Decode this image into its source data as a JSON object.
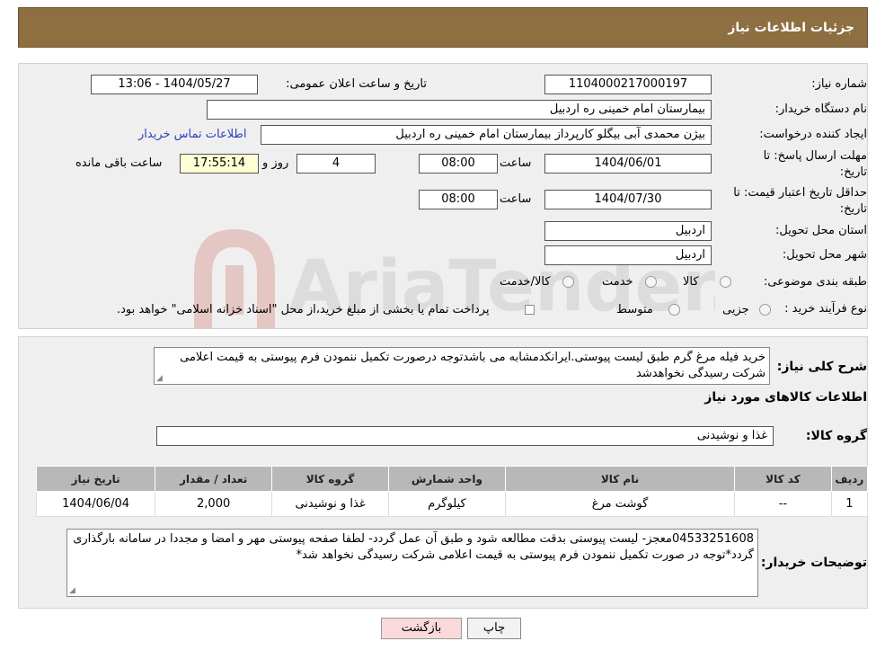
{
  "header": {
    "title": "جزئیات اطلاعات نیاز"
  },
  "form": {
    "need_number": {
      "label": "شماره نیاز:",
      "value": "1104000217000197"
    },
    "announce_datetime": {
      "label": "تاریخ و ساعت اعلان عمومی:",
      "value": "1404/05/27 - 13:06"
    },
    "buyer_org": {
      "label": "نام دستگاه خریدار:",
      "value": "بیمارستان امام خمینی  ره  اردبیل"
    },
    "requester": {
      "label": "ایجاد کننده درخواست:",
      "value": "بیژن محمدی آبی بیگلو کارپرداز بیمارستان امام خمینی  ره  اردبیل"
    },
    "contact_link": "اطلاعات تماس خریدار",
    "reply_deadline": {
      "label_line1": "مهلت ارسال پاسخ: تا",
      "label_line2": "تاریخ:",
      "date": "1404/06/01",
      "time_label": "ساعت",
      "time": "08:00",
      "days": "4",
      "days_label": "روز و",
      "remaining": "17:55:14",
      "remaining_label": "ساعت باقی مانده"
    },
    "price_validity": {
      "label_line1": "حداقل تاریخ اعتبار قیمت: تا",
      "label_line2": "تاریخ:",
      "date": "1404/07/30",
      "time_label": "ساعت",
      "time": "08:00"
    },
    "delivery_province": {
      "label": "استان محل تحویل:",
      "value": "اردبیل"
    },
    "delivery_city": {
      "label": "شهر محل تحویل:",
      "value": "اردبیل"
    },
    "category": {
      "label": "طبقه بندی موضوعی:",
      "options": [
        "کالا",
        "خدمت",
        "کالا/خدمت"
      ]
    },
    "purchase_process": {
      "label": "نوع فرآیند خرید :",
      "options": [
        "جزیی",
        "متوسط"
      ],
      "note": "پرداخت تمام یا بخشی از مبلغ خرید،از محل \"اسناد خزانه اسلامی\" خواهد بود."
    }
  },
  "summary": {
    "label": "شرح کلی نیاز:",
    "text": "خرید فیله مرغ گرم طبق لیست پیوستی.ایرانکدمشابه می باشدتوجه درصورت تکمیل ننمودن فرم پیوستی به قیمت اعلامی شرکت رسیدگی نخواهدشد"
  },
  "goods_section": {
    "title": "اطلاعات کالاهای مورد نیاز",
    "group_label": "گروه کالا:",
    "group_value": "غذا و نوشیدنی"
  },
  "table": {
    "columns": [
      "ردیف",
      "کد کالا",
      "نام کالا",
      "واحد شمارش",
      "گروه کالا",
      "تعداد / مقدار",
      "تاریخ نیاز"
    ],
    "rows": [
      [
        "1",
        "--",
        "گوشت مرغ",
        "کیلوگرم",
        "غذا و نوشیدنی",
        "2,000",
        "1404/06/04"
      ]
    ]
  },
  "buyer_notes": {
    "label": "توضیحات خریدار:",
    "text": "04533251608معجز- لیست پیوستی بدقت مطالعه شود و طبق آن عمل گردد- لطفا صفحه پیوستی مهر و امضا و مجددا در سامانه بارگذاری گردد*توجه در صورت تکمیل ننمودن فرم پیوستی به قیمت اعلامی شرکت رسیدگی نخواهد شد*"
  },
  "buttons": {
    "print": "چاپ",
    "back": "بازگشت"
  },
  "watermark": {
    "text": "AriaTender.neT",
    "icon": "aria-logo-icon"
  },
  "colors": {
    "header_bg": "#8e6f41",
    "back_button_bg": "#f9d9d9",
    "link": "#2a3fbf"
  }
}
